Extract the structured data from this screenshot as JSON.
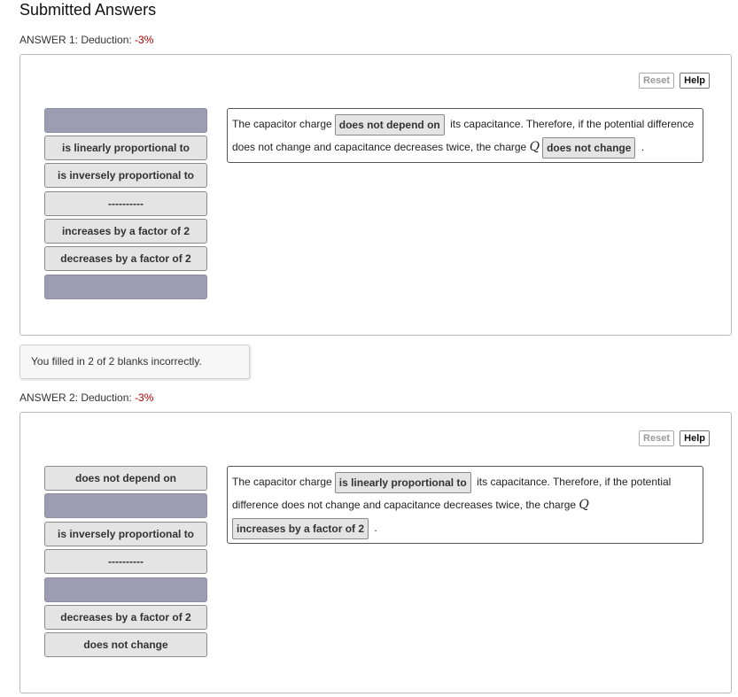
{
  "page_title": "Submitted Answers",
  "answers": [
    {
      "header_label": "ANSWER 1: Deduction:",
      "deduction": "-3%",
      "reset_label": "Reset",
      "help_label": "Help",
      "choices": [
        "",
        "is linearly proportional to",
        "is inversely proportional to",
        "----------",
        "increases by a factor of 2",
        "decreases by a factor of 2",
        ""
      ],
      "sentence": {
        "part1": "The capacitor charge",
        "blank1": "does not depend on",
        "part2": "its capacitance. Therefore, if the potential difference",
        "part3": "does not change and capacitance decreases twice, the charge",
        "variable": "Q",
        "blank2": "does not change",
        "end": "."
      }
    },
    {
      "header_label": "ANSWER 2: Deduction:",
      "deduction": "-3%",
      "reset_label": "Reset",
      "help_label": "Help",
      "choices": [
        "does not depend on",
        "",
        "is inversely proportional to",
        "----------",
        "",
        "decreases by a factor of 2",
        "does not change"
      ],
      "sentence": {
        "part1": "The capacitor charge",
        "blank1": "is linearly proportional to",
        "part2": "its capacitance. Therefore, if the potential",
        "part3": "difference does not change and capacitance decreases twice, the charge",
        "variable": "Q",
        "blank2": "increases by a factor of 2",
        "end": "."
      }
    }
  ],
  "feedback_1": "You filled in 2 of 2 blanks incorrectly.",
  "colors": {
    "deduction": "#b00000",
    "empty_choice": "#9c9cb3",
    "choice": "#e4e4e4"
  }
}
